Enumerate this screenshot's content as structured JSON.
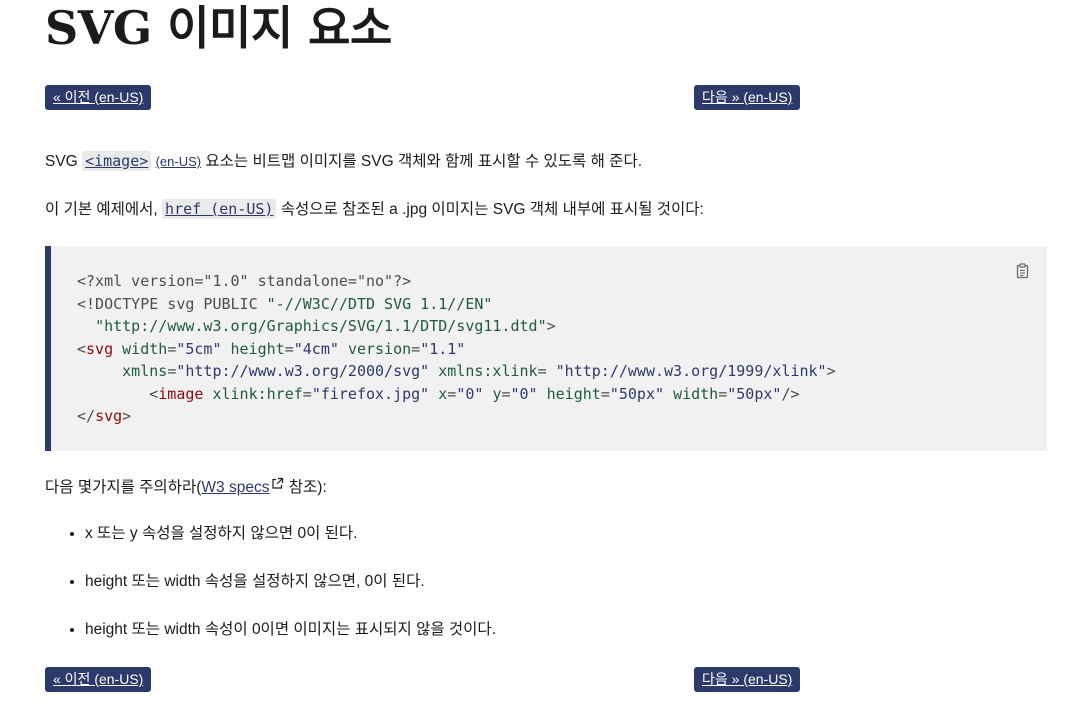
{
  "title": "SVG 이미지 요소",
  "nav": {
    "prev": "« 이전 (en-US)",
    "next": "다음 » (en-US)"
  },
  "intro": {
    "before": "SVG ",
    "image_code": "<image>",
    "image_locale": "(en-US)",
    "after": " 요소는 비트맵 이미지를 SVG 객체와 함께 표시할 수 있도록 해 준다."
  },
  "example": {
    "before": "이 기본 예제에서, ",
    "href_code": "href (en-US)",
    "after": " 속성으로 참조된 a .jpg 이미지는 SVG 객체 내부에 표시될 것이다:"
  },
  "code": {
    "copy_icon": "clipboard-icon",
    "xml_decl": "<?xml version=\"1.0\" standalone=\"no\"?>",
    "doctype_start": "<!DOCTYPE svg PUBLIC ",
    "doctype_public": "\"-//W3C//DTD SVG 1.1//EN\"",
    "doctype_system": "\"http://www.w3.org/Graphics/SVG/1.1/DTD/svg11.dtd\"",
    "doctype_end": ">",
    "svg_tag": "svg",
    "attr_width": "width",
    "val_width": "\"5cm\"",
    "attr_height": "height",
    "val_height": "\"4cm\"",
    "attr_version": "version",
    "val_version": "\"1.1\"",
    "attr_xmlns": "xmlns",
    "val_xmlns": "\"http://www.w3.org/2000/svg\"",
    "attr_xlink": "xmlns:xlink",
    "val_xlink": "\"http://www.w3.org/1999/xlink\"",
    "image_tag": "image",
    "attr_href": "xlink:href",
    "val_href": "\"firefox.jpg\"",
    "attr_x": "x",
    "val_x": "\"0\"",
    "attr_y": "y",
    "val_y": "\"0\"",
    "attr_img_height": "height",
    "val_img_height": "\"50px\"",
    "attr_img_width": "width",
    "val_img_width": "\"50px\""
  },
  "notes_intro": {
    "before": "다음 몇가지를 주의하라(",
    "link": "W3 specs",
    "link_icon": "external-link-icon",
    "after": " 참조):"
  },
  "notes": [
    "x 또는 y 속성을 설정하지 않으면 0이 된다.",
    "height 또는 width 속성을 설정하지 않으면, 0이 된다.",
    "height 또는 width 속성이 0이면 이미지는 표시되지 않을 것이다."
  ]
}
